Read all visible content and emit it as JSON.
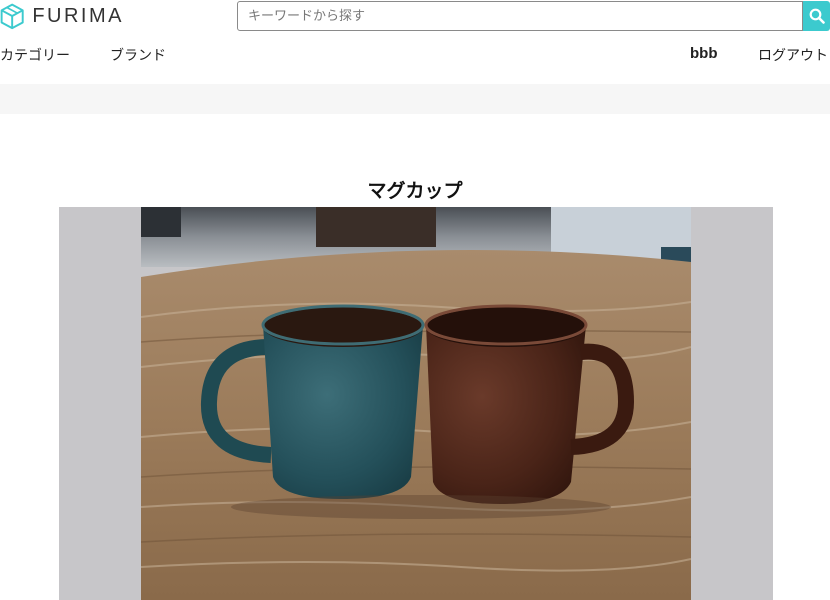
{
  "header": {
    "logo_text": "FURIMA",
    "search": {
      "placeholder": "キーワードから探す",
      "value": ""
    },
    "accent_color": "#3ccace"
  },
  "nav": {
    "category": "カテゴリー",
    "brand": "ブランド",
    "user_name": "bbb",
    "logout": "ログアウト"
  },
  "item": {
    "name": "マグカップ",
    "image_icon": "photo-two-mugs"
  }
}
